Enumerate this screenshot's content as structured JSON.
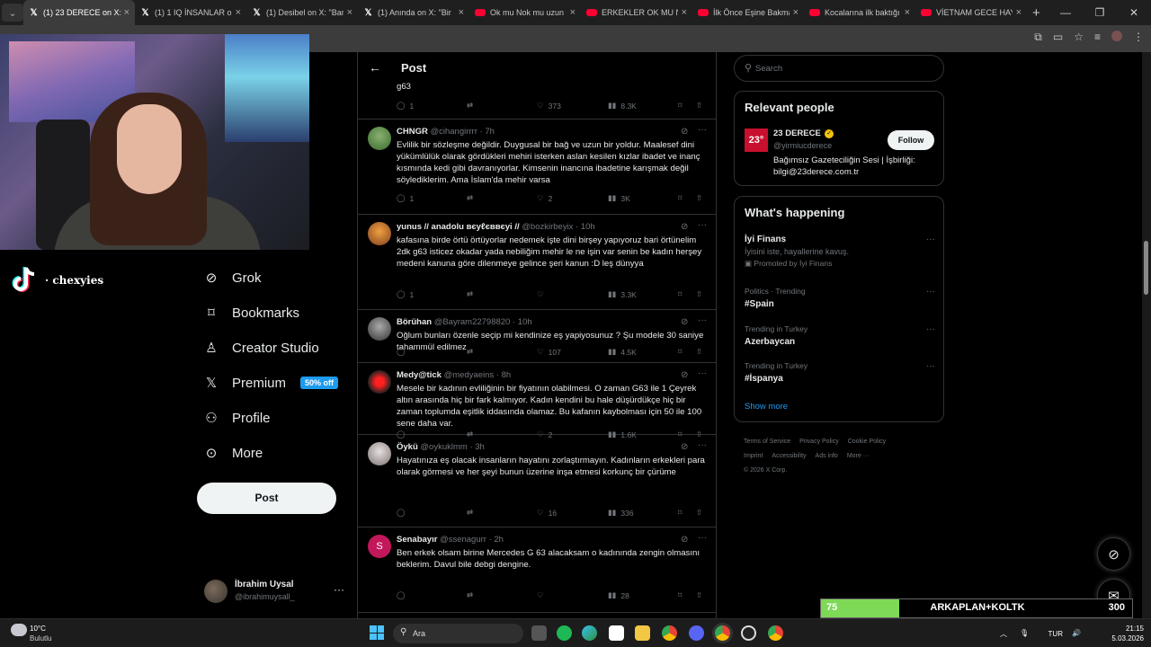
{
  "browser": {
    "tabs": [
      {
        "label": "(1) 23 DERECE on X: \"",
        "icon": "x-icon",
        "active": true
      },
      {
        "label": "(1) 1 IQ İNSANLAR on X",
        "icon": "x-icon"
      },
      {
        "label": "(1) Desibel on X: \"Bar",
        "icon": "x-icon"
      },
      {
        "label": "(1) Anında on X: \"Bir",
        "icon": "x-icon"
      },
      {
        "label": "Ok mu Nok mu uzun",
        "icon": "youtube-icon"
      },
      {
        "label": "ERKEKLER OK MU NOK",
        "icon": "youtube-icon"
      },
      {
        "label": "İlk Önce Eşine Bakma",
        "icon": "youtube-icon"
      },
      {
        "label": "Kocalarına ilk baktığı",
        "icon": "youtube-icon"
      },
      {
        "label": "VİETNAM GECE HAYA",
        "icon": "youtube-icon"
      }
    ]
  },
  "stream": {
    "tiktok_handle": "· chexyies",
    "bar_left": "75",
    "bar_mid": "ARKAPLAN+KOLTK",
    "bar_right": "300",
    "bar_fill": 0.25
  },
  "nav": {
    "items": [
      {
        "label": "Grok",
        "icon": "grok-icon"
      },
      {
        "label": "Bookmarks",
        "icon": "bookmark-icon"
      },
      {
        "label": "Creator Studio",
        "icon": "creator-studio-icon"
      },
      {
        "label": "Premium",
        "icon": "x-logo-icon"
      },
      {
        "label": "Profile",
        "icon": "person-icon"
      },
      {
        "label": "More",
        "icon": "more-circle-icon"
      }
    ],
    "premium_badge": "50% off",
    "post_button": "Post",
    "account": {
      "name": "İbrahim Uysal",
      "handle": "@ibrahimuysall_"
    }
  },
  "header": {
    "title": "Post"
  },
  "prev_tweet": {
    "body_fragment": "g63",
    "replies": "1",
    "reposts": "",
    "likes": "373",
    "views": "8.3K"
  },
  "tweets": [
    {
      "name": "CHNGR",
      "handle": "@cihangirrrr · 7h",
      "body": "Evlilik bir sözleşme değildir. Duygusal bir bağ ve uzun bir yoldur. Maalesef dini yükümlülük olarak gördükleri mehiri isterken aslan kesilen kızlar ibadet ve inanç kısmında kedi gibi davranıyorlar. Kimsenin inancına ibadetine karışmak değil söylediklerim. Ama İslam'da mehir varsa",
      "replies": "1",
      "reposts": "",
      "likes": "2",
      "views": "3K"
    },
    {
      "name": "yunus // anadolu вєуℓєввєуі //",
      "handle": "@bozkirbeyix · 10h",
      "body": "kafasına birde örtü örtüyorlar nedemek işte dini birşey yapıyoruz bari örtünelim 2dk g63 isticez okadar yada nebiliğim mehir le ne işin var senin be kadın herşey medeni kanuna göre dilenmeye gelince şeri kanun :D leş dünyya",
      "replies": "1",
      "reposts": "",
      "likes": "",
      "views": "3.3K"
    },
    {
      "name": "Börühan",
      "handle": "@Bayram22798820 · 10h",
      "body": "Oğlum bunları özenle seçip mi kendinize eş yapiyosunuz ? Şu modele 30 saniye tahammül edilmez",
      "replies": "",
      "reposts": "",
      "likes": "107",
      "views": "4.5K"
    },
    {
      "name": "Medy@tick",
      "handle": "@medyaeins · 8h",
      "body": "Mesele bir kadının evliliğinin bir fiyatının olabilmesi. O zaman G63 ile 1 Çeyrek altın arasında hiç bir fark kalmıyor. Kadın kendini bu hale düşürdükçe hiç bir zaman toplumda eşitlik iddasında olamaz. Bu kafanın kaybolması için 50 ile 100 sene daha var.",
      "replies": "",
      "reposts": "",
      "likes": "2",
      "views": "1.6K"
    },
    {
      "name": "Öykü",
      "handle": "@oykuklmm · 3h",
      "body": "Hayatınıza eş olacak insanların hayatını zorlaştırmayın. Kadınların erkekleri para olarak görmesi ve her şeyi bunun üzerine inşa etmesi korkunç bir çürüme",
      "replies": "",
      "reposts": "",
      "likes": "16",
      "views": "336"
    },
    {
      "name": "Senabayır",
      "handle": "@ssenagurr · 2h",
      "body": "Ben erkek olsam birine Mercedes G 63 alacaksam o kadınında zengin olmasını beklerim. Davul bile debgi dengine.",
      "replies": "",
      "reposts": "",
      "likes": "",
      "views": "28",
      "avatar_letter": "S"
    }
  ],
  "sidebar": {
    "search_placeholder": "Search",
    "relevant": {
      "title": "Relevant people",
      "logo_text": "23°",
      "name": "23 DERECE",
      "handle": "@yirmiucderece",
      "follow": "Follow",
      "bio": "Bağımsız Gazeteciliğin Sesi | İşbirliği: bilgi@23derece.com.tr"
    },
    "happening": {
      "title": "What's happening",
      "items": [
        {
          "meta": "",
          "title": "İyi Finans",
          "sub": "İyisini iste, hayallerine kavuş.",
          "promo": "Promoted by İyi Finans"
        },
        {
          "meta": "Politics · Trending",
          "title": "#Spain"
        },
        {
          "meta": "Trending in Turkey",
          "title": "Azerbaycan"
        },
        {
          "meta": "Trending in Turkey",
          "title": "#İspanya"
        }
      ],
      "show_more": "Show more"
    },
    "footer": [
      "Terms of Service",
      "Privacy Policy",
      "Cookie Policy",
      "Imprint",
      "Accessibility",
      "Ads info",
      "More ···",
      "© 2026 X Corp."
    ]
  },
  "taskbar": {
    "temp": "10°C",
    "condition": "Bulutlu",
    "search_placeholder": "Ara",
    "ime": "TUR",
    "time": "21:15",
    "date": "5.03.2026"
  }
}
